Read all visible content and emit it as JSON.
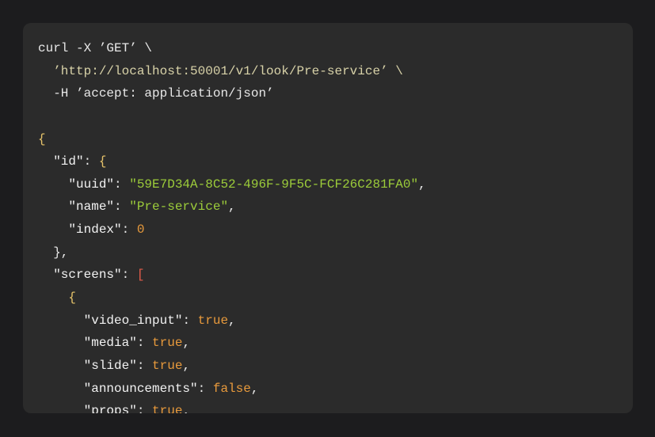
{
  "code_block": {
    "language": "curl + json",
    "colors": {
      "background": "#2b2b2b",
      "string": "#9ccc3a",
      "boolean": "#e89a3c",
      "number": "#e89a3c",
      "brace": "#e6c36a",
      "bracket": "#e25b4a"
    },
    "lines": [
      {
        "indent": 0,
        "tokens": [
          {
            "t": "curl -X ’GET’ \\",
            "c": "plain"
          }
        ]
      },
      {
        "indent": 1,
        "tokens": [
          {
            "t": "’http://localhost:50001/v1/look/Pre-service’ \\",
            "c": "url"
          }
        ]
      },
      {
        "indent": 1,
        "tokens": [
          {
            "t": "-H ’accept: application/json’",
            "c": "plain"
          }
        ]
      },
      {
        "indent": 0,
        "tokens": []
      },
      {
        "indent": 0,
        "tokens": [
          {
            "t": "{",
            "c": "brace"
          }
        ]
      },
      {
        "indent": 1,
        "tokens": [
          {
            "t": "″id″",
            "c": "key"
          },
          {
            "t": ": ",
            "c": "punct"
          },
          {
            "t": "{",
            "c": "brace"
          }
        ]
      },
      {
        "indent": 2,
        "tokens": [
          {
            "t": "″uuid″",
            "c": "key"
          },
          {
            "t": ": ",
            "c": "punct"
          },
          {
            "t": "″59E7D34A-8C52-496F-9F5C-FCF26C281FA0″",
            "c": "str"
          },
          {
            "t": ",",
            "c": "punct"
          }
        ]
      },
      {
        "indent": 2,
        "tokens": [
          {
            "t": "″name″",
            "c": "key"
          },
          {
            "t": ": ",
            "c": "punct"
          },
          {
            "t": "″Pre-service″",
            "c": "str"
          },
          {
            "t": ",",
            "c": "punct"
          }
        ]
      },
      {
        "indent": 2,
        "tokens": [
          {
            "t": "″index″",
            "c": "key"
          },
          {
            "t": ": ",
            "c": "punct"
          },
          {
            "t": "0",
            "c": "num"
          }
        ]
      },
      {
        "indent": 1,
        "tokens": [
          {
            "t": "},",
            "c": "punct"
          }
        ]
      },
      {
        "indent": 1,
        "tokens": [
          {
            "t": "″screens″",
            "c": "key"
          },
          {
            "t": ": ",
            "c": "punct"
          },
          {
            "t": "[",
            "c": "bracket"
          }
        ]
      },
      {
        "indent": 2,
        "tokens": [
          {
            "t": "{",
            "c": "brace"
          }
        ]
      },
      {
        "indent": 3,
        "tokens": [
          {
            "t": "″video_input″",
            "c": "key"
          },
          {
            "t": ": ",
            "c": "punct"
          },
          {
            "t": "true",
            "c": "bool"
          },
          {
            "t": ",",
            "c": "punct"
          }
        ]
      },
      {
        "indent": 3,
        "tokens": [
          {
            "t": "″media″",
            "c": "key"
          },
          {
            "t": ": ",
            "c": "punct"
          },
          {
            "t": "true",
            "c": "bool"
          },
          {
            "t": ",",
            "c": "punct"
          }
        ]
      },
      {
        "indent": 3,
        "tokens": [
          {
            "t": "″slide″",
            "c": "key"
          },
          {
            "t": ": ",
            "c": "punct"
          },
          {
            "t": "true",
            "c": "bool"
          },
          {
            "t": ",",
            "c": "punct"
          }
        ]
      },
      {
        "indent": 3,
        "tokens": [
          {
            "t": "″announcements″",
            "c": "key"
          },
          {
            "t": ": ",
            "c": "punct"
          },
          {
            "t": "false",
            "c": "bool"
          },
          {
            "t": ",",
            "c": "punct"
          }
        ]
      },
      {
        "indent": 3,
        "tokens": [
          {
            "t": "″props″",
            "c": "key"
          },
          {
            "t": ": ",
            "c": "punct"
          },
          {
            "t": "true",
            "c": "bool"
          },
          {
            "t": ",",
            "c": "punct"
          }
        ]
      }
    ]
  }
}
